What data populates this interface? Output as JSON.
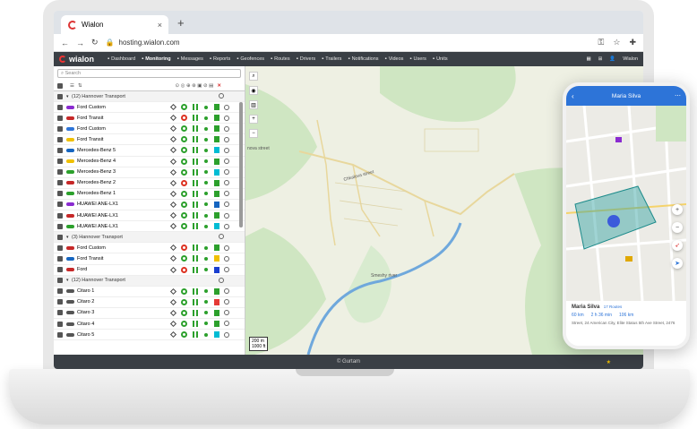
{
  "browser": {
    "tab_title": "Wialon",
    "tab_close": "×",
    "new_tab": "+",
    "url": "hosting.wialon.com"
  },
  "app": {
    "brand": "wialon",
    "menu": [
      {
        "label": "Dashboard",
        "icon": "dashboard-icon"
      },
      {
        "label": "Monitoring",
        "icon": "monitoring-icon",
        "active": true
      },
      {
        "label": "Messages",
        "icon": "messages-icon"
      },
      {
        "label": "Reports",
        "icon": "reports-icon"
      },
      {
        "label": "Geofences",
        "icon": "geofences-icon"
      },
      {
        "label": "Routes",
        "icon": "routes-icon"
      },
      {
        "label": "Drivers",
        "icon": "drivers-icon"
      },
      {
        "label": "Trailers",
        "icon": "trailers-icon"
      },
      {
        "label": "Notifications",
        "icon": "notifications-icon"
      },
      {
        "label": "Videos",
        "icon": "videos-icon"
      },
      {
        "label": "Users",
        "icon": "users-icon"
      },
      {
        "label": "Units",
        "icon": "units-icon"
      }
    ],
    "user": "Wialon"
  },
  "panel": {
    "search_placeholder": "Search",
    "rows": [
      {
        "type": "group",
        "label": "(12) Hannover Transport"
      },
      {
        "type": "unit",
        "label": "Ford Custom",
        "color": "#8a2bd0",
        "gps": "green",
        "status": "#2ca02c"
      },
      {
        "type": "unit",
        "label": "Ford Transit",
        "color": "#c62828",
        "gps": "red",
        "status": "#2ca02c"
      },
      {
        "type": "unit",
        "label": "Ford Custom",
        "color": "#2d74d8",
        "gps": "green",
        "status": "#2ca02c"
      },
      {
        "type": "unit",
        "label": "Ford Transit",
        "color": "#f0c000",
        "gps": "green",
        "status": "#2ca02c"
      },
      {
        "type": "unit",
        "label": "Mercedes-Benz 5",
        "color": "#1565c0",
        "gps": "green",
        "status": "#00bcd4"
      },
      {
        "type": "unit",
        "label": "Mercedes-Benz 4",
        "color": "#f0c000",
        "gps": "green",
        "status": "#2ca02c"
      },
      {
        "type": "unit",
        "label": "Mercedes-Benz 3",
        "color": "#2ca02c",
        "gps": "green",
        "status": "#00bcd4"
      },
      {
        "type": "unit",
        "label": "Mercedes-Benz 2",
        "color": "#c62828",
        "gps": "red",
        "status": "#2ca02c"
      },
      {
        "type": "unit",
        "label": "Mercedes-Benz 1",
        "color": "#2ca02c",
        "gps": "green",
        "status": "#2ca02c"
      },
      {
        "type": "unit",
        "label": "HUAWEI ANE-LX1",
        "color": "#8a2bd0",
        "gps": "green",
        "status": "#1565c0"
      },
      {
        "type": "unit",
        "label": "HUAWEI ANE-LX1",
        "color": "#c62828",
        "gps": "green",
        "status": "#2ca02c"
      },
      {
        "type": "unit",
        "label": "HUAWEI ANE-LX1",
        "color": "#2ca02c",
        "gps": "green",
        "status": "#00bcd4"
      },
      {
        "type": "group",
        "label": "(3) Hannover Transport"
      },
      {
        "type": "unit",
        "label": "Ford Custom",
        "color": "#c62828",
        "gps": "red",
        "status": "#2ca02c"
      },
      {
        "type": "unit",
        "label": "Ford Transit",
        "color": "#1565c0",
        "gps": "green",
        "status": "#f0c000"
      },
      {
        "type": "unit",
        "label": "Ford",
        "color": "#c62828",
        "gps": "red",
        "status": "#1a3fd0"
      },
      {
        "type": "group",
        "label": "(12) Hannover Transport"
      },
      {
        "type": "unit",
        "label": "Citaro 1",
        "color": "#555555",
        "gps": "green",
        "status": "#2ca02c"
      },
      {
        "type": "unit",
        "label": "Citaro 2",
        "color": "#555555",
        "gps": "green",
        "status": "#e53935"
      },
      {
        "type": "unit",
        "label": "Citaro 3",
        "color": "#555555",
        "gps": "green",
        "status": "#2ca02c"
      },
      {
        "type": "unit",
        "label": "Citaro 4",
        "color": "#555555",
        "gps": "green",
        "status": "#2ca02c"
      },
      {
        "type": "unit",
        "label": "Citaro 5",
        "color": "#555555",
        "gps": "green",
        "status": "#00bcd4"
      }
    ]
  },
  "map": {
    "labels": [
      "Chkalova street",
      "Smeshy river",
      "nova street"
    ],
    "scale_top": "200 m",
    "scale_bottom": "1000 ft"
  },
  "footer": "© Gurtam",
  "phone": {
    "title": "Maria Silva",
    "name": "Maria Silva",
    "tag": "17 Routes",
    "distance": "60 km",
    "duration": "2 h 36 min",
    "speed": "106 km",
    "address": "Street, 24 American City, Elite Status 5th Ave Street, 2476"
  }
}
